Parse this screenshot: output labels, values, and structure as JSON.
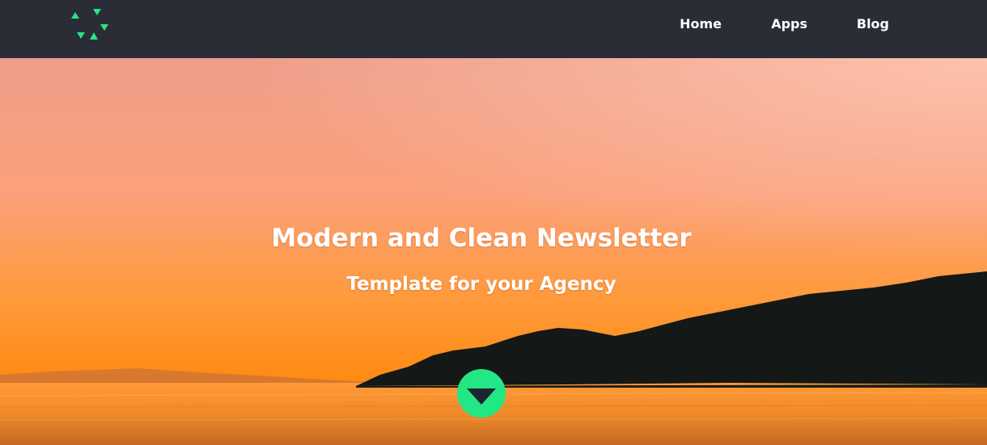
{
  "header": {
    "logo_icon": "triangle-cluster-logo",
    "nav": [
      {
        "label": "Home"
      },
      {
        "label": "Apps"
      },
      {
        "label": "Blog"
      }
    ]
  },
  "hero": {
    "title": "Modern and Clean Newsletter",
    "subtitle": "Template for your Agency",
    "background": "sunset-over-sea-photo",
    "scroll_icon": "arrow-down-icon"
  },
  "colors": {
    "header_bg": "#2a2d36",
    "accent": "#23e784",
    "text": "#ffffff",
    "sky_top": "#f0a08a",
    "sky_horizon": "#ff8a10"
  }
}
